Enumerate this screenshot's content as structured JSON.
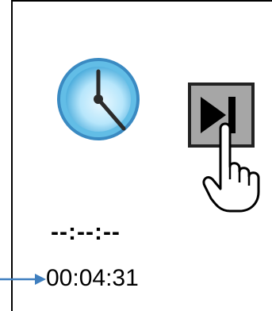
{
  "panel": {
    "icons": {
      "clock": "clock-icon",
      "skip": "skip-next-icon",
      "hand": "pointing-hand-icon",
      "arrow": "arrow-right-icon"
    },
    "time_placeholder": "--:--:--",
    "time_value": "00:04:31"
  },
  "colors": {
    "clock_face": "#4fb4df",
    "clock_face_light": "#d9f1fb",
    "button_fill": "#a6a6a6",
    "arrow": "#3f7fbf"
  }
}
